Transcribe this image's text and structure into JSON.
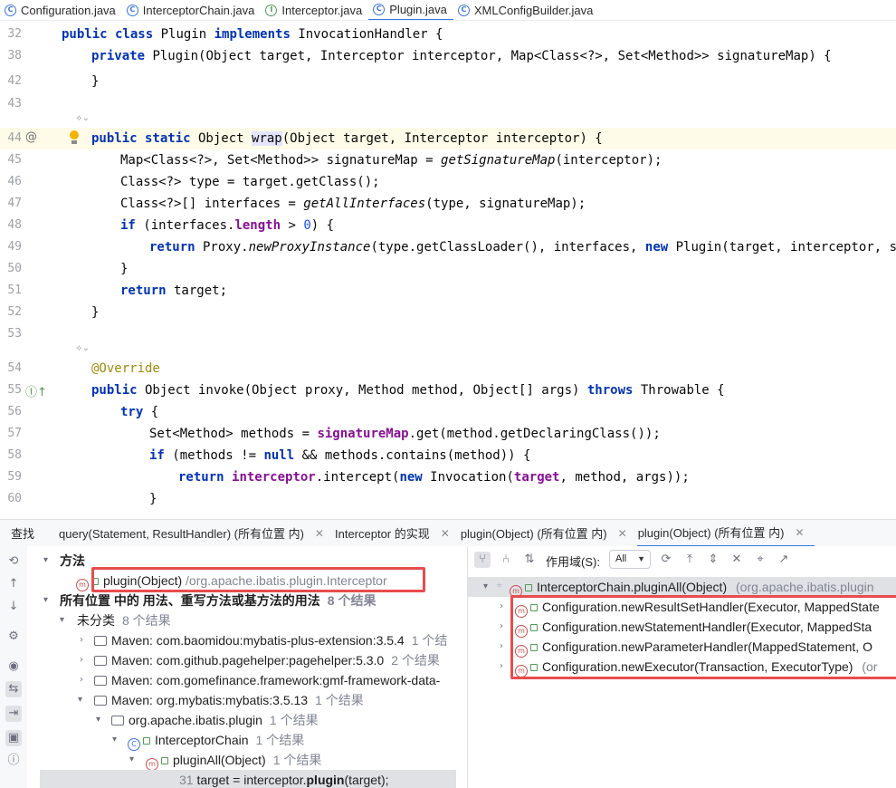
{
  "file_tabs": [
    {
      "label": "Configuration.java",
      "kind": "class"
    },
    {
      "label": "InterceptorChain.java",
      "kind": "class"
    },
    {
      "label": "Interceptor.java",
      "kind": "interface"
    },
    {
      "label": "Plugin.java",
      "kind": "class",
      "active": true
    },
    {
      "label": "XMLConfigBuilder.java",
      "kind": "class"
    }
  ],
  "editor": {
    "line_numbers": [
      "32",
      "38",
      "42",
      "43",
      "",
      "44",
      "45",
      "46",
      "47",
      "48",
      "49",
      "50",
      "51",
      "52",
      "53",
      "",
      "54",
      "55",
      "56",
      "57",
      "58",
      "59",
      "60"
    ],
    "lines": {
      "l32": {
        "kw1": "public class",
        "t1": " Plugin ",
        "kw2": "implements",
        "t2": " InvocationHandler {"
      },
      "l38": {
        "kw1": "private",
        "t1": " Plugin(Object target, Interceptor interceptor, Map<Class<?>, Set<Method>> signatureMap) {"
      },
      "l42": {
        "t1": "}"
      },
      "l44": {
        "kw1": "public static",
        "t1": " Object ",
        "sel": "wrap",
        "t2": "(Object target, Interceptor interceptor) {"
      },
      "l45": {
        "t1": "Map<Class<?>, Set<Method>> signatureMap = ",
        "it1": "getSignatureMap",
        "t2": "(interceptor);"
      },
      "l46": {
        "t1": "Class<?> type = target.getClass();"
      },
      "l47": {
        "t1": "Class<?>[] interfaces = ",
        "it1": "getAllInterfaces",
        "t2": "(type, signatureMap);"
      },
      "l48": {
        "kw1": "if",
        "t1": " (interfaces.",
        "fld1": "length",
        "t2": " > ",
        "num1": "0",
        "t3": ") {"
      },
      "l49": {
        "kw1": "return",
        "t1": " Proxy.",
        "it1": "newProxyInstance",
        "t2": "(type.getClassLoader(), interfaces, ",
        "kw2": "new",
        "t3": " Plugin(target, interceptor, s"
      },
      "l50": {
        "t1": "}"
      },
      "l51": {
        "kw1": "return",
        "t1": " target;"
      },
      "l52": {
        "t1": "}"
      },
      "l54": {
        "ann": "@Override"
      },
      "l55": {
        "kw1": "public",
        "t1": " Object invoke(Object proxy, Method method, Object[] args) ",
        "kw2": "throws",
        "t2": " Throwable {"
      },
      "l56": {
        "kw1": "try",
        "t1": " {"
      },
      "l57": {
        "t1": "Set<Method> methods = ",
        "fld1": "signatureMap",
        "t2": ".get(method.getDeclaringClass());"
      },
      "l58": {
        "kw1": "if",
        "t1": " (methods != ",
        "kw2": "null",
        "t2": " && methods.contains(method)) {"
      },
      "l59": {
        "kw1": "return",
        "t0": " ",
        "fld1": "interceptor",
        "t1": ".intercept(",
        "kw2": "new",
        "t2": " Invocation(",
        "fld2": "target",
        "t3": ", method, args));"
      },
      "l60": {
        "t1": "}"
      }
    }
  },
  "find_panel": {
    "title": "查找",
    "tabs": [
      {
        "label": "query(Statement, ResultHandler) (所有位置 内)",
        "closable": true
      },
      {
        "label": "Interceptor 的实现",
        "closable": true
      },
      {
        "label": "plugin(Object) (所有位置 内)",
        "closable": true
      },
      {
        "label": "plugin(Object) (所有位置 内)",
        "closable": true,
        "active": true
      }
    ],
    "tree": {
      "methods_header": "方法",
      "method_name": "plugin(Object)",
      "method_path": "/org.apache.ibatis.plugin.Interceptor",
      "usages_header": "所有位置 中的 用法、重写方法或基方法的用法",
      "usages_count": "8 个结果",
      "uncategorized": "未分类",
      "uncategorized_count": "8 个结果",
      "maven": [
        {
          "label": "Maven: com.baomidou:mybatis-plus-extension:3.5.4",
          "count": "1 个结"
        },
        {
          "label": "Maven: com.github.pagehelper:pagehelper:5.3.0",
          "count": "2 个结果"
        },
        {
          "label": "Maven: com.gomefinance.framework:gmf-framework-data-",
          "count": ""
        },
        {
          "label": "Maven: org.mybatis:mybatis:3.5.13",
          "count": "1 个结果"
        }
      ],
      "package": {
        "label": "org.apache.ibatis.plugin",
        "count": "1 个结果"
      },
      "klass": {
        "label": "InterceptorChain",
        "count": "1 个结果"
      },
      "method": {
        "label": "pluginAll(Object)",
        "count": "1 个结果"
      },
      "usage": {
        "line": "31",
        "pre": "target = interceptor.",
        "bold": "plugin",
        "post": "(target);"
      }
    },
    "hierarchy": {
      "scope_label": "作用域(S):",
      "scope_value": "All",
      "root": {
        "label": "InterceptorChain.pluginAll(Object)",
        "pkg": "(org.apache.ibatis.plugin"
      },
      "callers": [
        {
          "label": "Configuration.newResultSetHandler(Executor, MappedState"
        },
        {
          "label": "Configuration.newStatementHandler(Executor, MappedSta"
        },
        {
          "label": "Configuration.newParameterHandler(MappedStatement, O"
        },
        {
          "label": "Configuration.newExecutor(Transaction, ExecutorType)",
          "pkg": "(or"
        }
      ]
    }
  }
}
